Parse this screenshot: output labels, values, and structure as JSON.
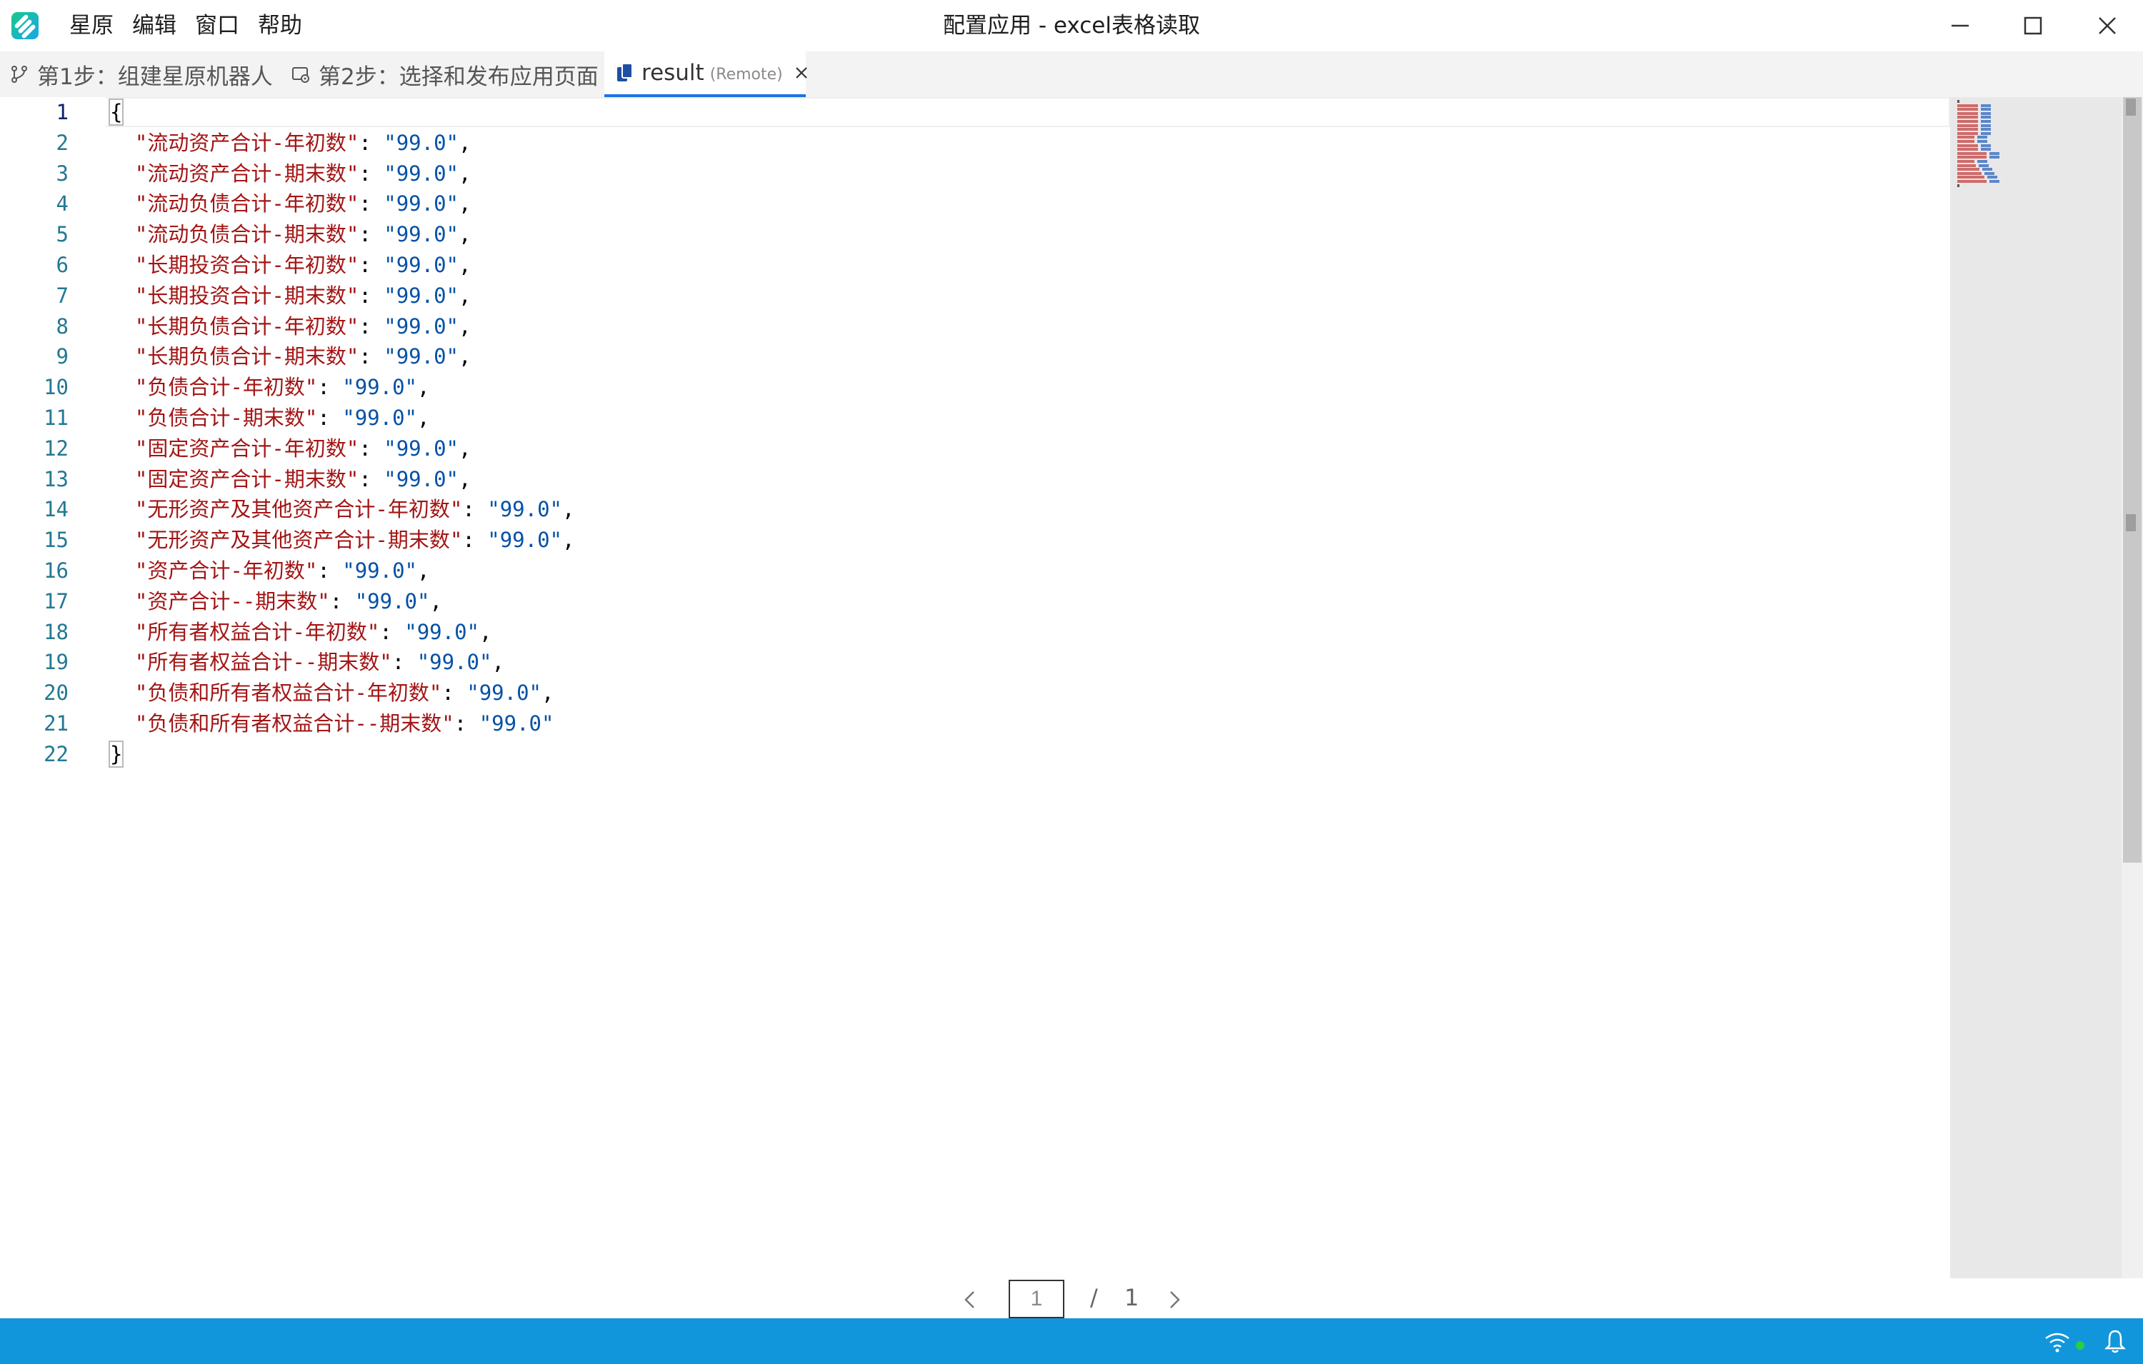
{
  "menu": {
    "items": [
      "星原",
      "编辑",
      "窗口",
      "帮助"
    ]
  },
  "window": {
    "title": "配置应用 - excel表格读取"
  },
  "tabs": [
    {
      "label": "第1步：组建星原机器人",
      "icon": "branch-icon"
    },
    {
      "label": "第2步：选择和发布应用页面",
      "icon": "settings-page-icon"
    },
    {
      "label": "result",
      "badge": "(Remote)",
      "icon": "file-copy-icon",
      "active": true
    }
  ],
  "editor": {
    "open_brace": "{",
    "close_brace": "}",
    "entries": [
      {
        "key": "\"流动资产合计-年初数\"",
        "value": "\"99.0\""
      },
      {
        "key": "\"流动资产合计-期末数\"",
        "value": "\"99.0\""
      },
      {
        "key": "\"流动负债合计-年初数\"",
        "value": "\"99.0\""
      },
      {
        "key": "\"流动负债合计-期末数\"",
        "value": "\"99.0\""
      },
      {
        "key": "\"长期投资合计-年初数\"",
        "value": "\"99.0\""
      },
      {
        "key": "\"长期投资合计-期末数\"",
        "value": "\"99.0\""
      },
      {
        "key": "\"长期负债合计-年初数\"",
        "value": "\"99.0\""
      },
      {
        "key": "\"长期负债合计-期末数\"",
        "value": "\"99.0\""
      },
      {
        "key": "\"负债合计-年初数\"",
        "value": "\"99.0\""
      },
      {
        "key": "\"负债合计-期末数\"",
        "value": "\"99.0\""
      },
      {
        "key": "\"固定资产合计-年初数\"",
        "value": "\"99.0\""
      },
      {
        "key": "\"固定资产合计-期末数\"",
        "value": "\"99.0\""
      },
      {
        "key": "\"无形资产及其他资产合计-年初数\"",
        "value": "\"99.0\""
      },
      {
        "key": "\"无形资产及其他资产合计-期末数\"",
        "value": "\"99.0\""
      },
      {
        "key": "\"资产合计-年初数\"",
        "value": "\"99.0\""
      },
      {
        "key": "\"资产合计--期末数\"",
        "value": "\"99.0\""
      },
      {
        "key": "\"所有者权益合计-年初数\"",
        "value": "\"99.0\""
      },
      {
        "key": "\"所有者权益合计--期末数\"",
        "value": "\"99.0\""
      },
      {
        "key": "\"负债和所有者权益合计-年初数\"",
        "value": "\"99.0\""
      },
      {
        "key": "\"负债和所有者权益合计--期末数\"",
        "value": "\"99.0\""
      }
    ],
    "line_numbers": [
      "1",
      "2",
      "3",
      "4",
      "5",
      "6",
      "7",
      "8",
      "9",
      "10",
      "11",
      "12",
      "13",
      "14",
      "15",
      "16",
      "17",
      "18",
      "19",
      "20",
      "21",
      "22"
    ]
  },
  "pager": {
    "current": "1",
    "separator": "/",
    "total": "1"
  },
  "colors": {
    "accent": "#1a73e8",
    "statusbar": "#1296db",
    "json_key": "#a31515",
    "json_value": "#0451a5",
    "line_number": "#237893"
  }
}
